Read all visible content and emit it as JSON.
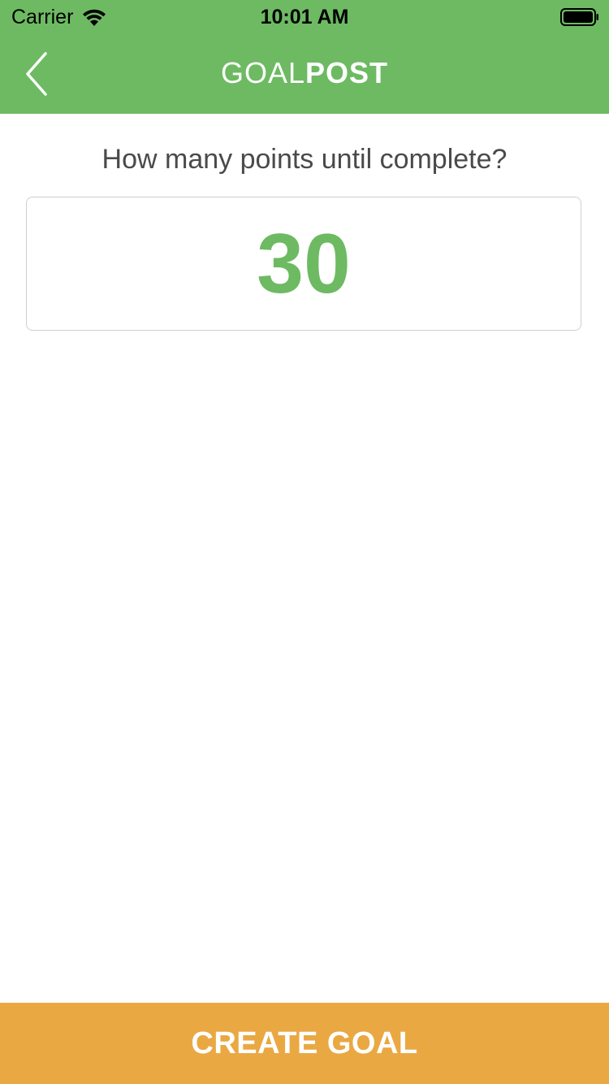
{
  "status_bar": {
    "carrier": "Carrier",
    "time": "10:01 AM",
    "wifi_icon": "wifi-icon",
    "battery_icon": "battery-full-icon"
  },
  "nav": {
    "back_icon": "chevron-left-icon",
    "title_light": "GOAL",
    "title_bold": "POST"
  },
  "form": {
    "question": "How many points until complete?",
    "points_value": "30"
  },
  "actions": {
    "create_label": "CREATE GOAL"
  },
  "colors": {
    "brand_green": "#6dba62",
    "accent_orange": "#eaa843",
    "text_gray": "#4a4a4a"
  }
}
